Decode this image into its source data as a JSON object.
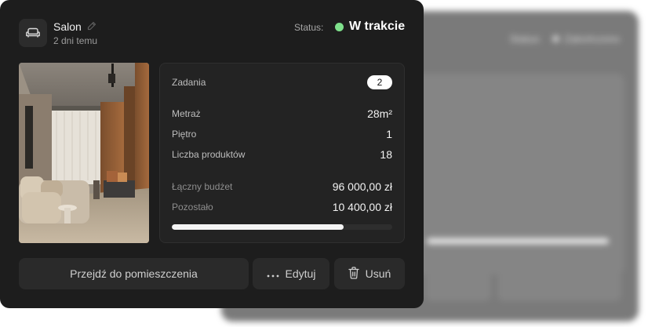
{
  "room": {
    "name": "Salon",
    "subtitle": "2 dni temu",
    "status_label": "Status:",
    "status_value": "W trakcie"
  },
  "details": {
    "tasks_label": "Zadania",
    "tasks_count": "2",
    "area_label": "Metraż",
    "area_value": "28m²",
    "floor_label": "Piętro",
    "floor_value": "1",
    "products_label": "Liczba produktów",
    "products_value": "18",
    "budget_label": "Łączny budżet",
    "budget_value": "96 000,00 zł",
    "remaining_label": "Pozostało",
    "remaining_value": "10 400,00 zł",
    "budget_progress": 0.78
  },
  "actions": {
    "go_label": "Przejdź do pomieszczenia",
    "edit_label": "Edytuj",
    "delete_label": "Usuń"
  },
  "icons": {
    "room": "sofa-icon",
    "edit_name": "pencil-icon",
    "edit": "dots-icon",
    "delete": "trash-icon"
  },
  "colors": {
    "status": "#7ee08b",
    "card_bg": "#1d1d1d"
  },
  "background_card": {
    "status_value": "Zakończono"
  }
}
